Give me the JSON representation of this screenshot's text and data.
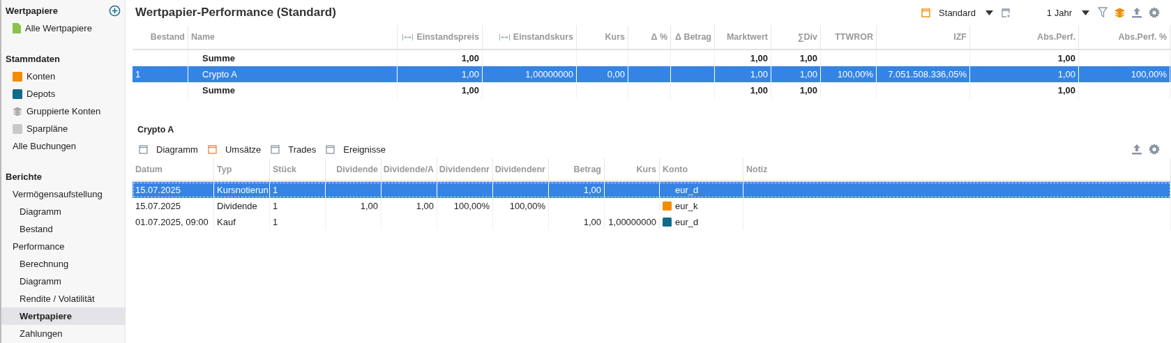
{
  "sidebar": {
    "sections": [
      {
        "title": "Wertpapiere",
        "add_button": true,
        "items": [
          {
            "label": "Alle Wertpapiere",
            "kind": "document",
            "color": "#8bc34a",
            "selected": false
          }
        ]
      },
      {
        "title": "Stammdaten",
        "items": [
          {
            "label": "Konten",
            "kind": "book",
            "color": "#f28c00",
            "selected": false
          },
          {
            "label": "Depots",
            "kind": "book",
            "color": "#0f6b8a",
            "selected": false
          },
          {
            "label": "Gruppierte Konten",
            "kind": "layers",
            "selected": false
          },
          {
            "label": "Sparpläne",
            "kind": "book",
            "color": "#c8c8c8",
            "selected": false
          },
          {
            "label": "Alle Buchungen",
            "kind": "plain",
            "selected": false
          }
        ]
      },
      {
        "title": "Berichte",
        "items": [
          {
            "label": "Vermögensaufstellung",
            "kind": "plain",
            "selected": false,
            "children": [
              {
                "label": "Diagramm",
                "selected": false
              },
              {
                "label": "Bestand",
                "selected": false
              }
            ]
          },
          {
            "label": "Performance",
            "kind": "plain",
            "selected": false,
            "children": [
              {
                "label": "Berechnung",
                "selected": false
              },
              {
                "label": "Diagramm",
                "selected": false
              },
              {
                "label": "Rendite / Volatilität",
                "selected": false
              },
              {
                "label": "Wertpapiere",
                "selected": true
              },
              {
                "label": "Zahlungen",
                "selected": false
              }
            ]
          }
        ]
      }
    ]
  },
  "page": {
    "title": "Wertpapier-Performance (Standard)",
    "toolbar": {
      "view": "Standard",
      "period": "1 Jahr"
    },
    "table": {
      "columns": [
        {
          "label": "Bestand"
        },
        {
          "label": "Name"
        },
        {
          "label": "Einstandspreis",
          "range_icon": true
        },
        {
          "label": "Einstandskurs",
          "range_icon": true
        },
        {
          "label": "Kurs"
        },
        {
          "label": "Δ %"
        },
        {
          "label": "Δ Betrag"
        },
        {
          "label": "Marktwert"
        },
        {
          "label": "∑Div"
        },
        {
          "label": "TTWROR"
        },
        {
          "label": "IZF"
        },
        {
          "label": "Abs.Perf."
        },
        {
          "label": "Abs.Perf. %"
        }
      ],
      "rows": [
        {
          "kind": "sum",
          "selected": false,
          "cells": [
            null,
            "Summe",
            "1,00",
            null,
            null,
            null,
            null,
            "1,00",
            "1,00",
            null,
            null,
            "1,00",
            null
          ]
        },
        {
          "kind": "position",
          "selected": true,
          "cells": [
            "1",
            "Crypto A",
            "1,00",
            "1,00000000",
            "0,00",
            null,
            null,
            "1,00",
            "1,00",
            "100,00%",
            "7.051.508.336,05%",
            "1,00",
            "100,00%"
          ]
        },
        {
          "kind": "sum",
          "selected": false,
          "cells": [
            null,
            "Summe",
            "1,00",
            null,
            null,
            null,
            null,
            "1,00",
            "1,00",
            null,
            null,
            "1,00",
            null
          ]
        }
      ]
    },
    "detail": {
      "title": "Crypto A",
      "tabs": [
        {
          "label": "Diagramm",
          "selected": false
        },
        {
          "label": "Umsätze",
          "selected": true
        },
        {
          "label": "Trades",
          "selected": false
        },
        {
          "label": "Ereignisse",
          "selected": false
        }
      ],
      "table": {
        "columns": [
          "Datum",
          "Typ",
          "Stück",
          "Dividende",
          "Dividende/A",
          "Dividendenr",
          "Dividendenr",
          "Betrag",
          "Kurs",
          "Konto",
          "Notiz"
        ],
        "rows": [
          {
            "selected": true,
            "cells": [
              "15.07.2025",
              "Kursnotierun",
              "1",
              null,
              null,
              null,
              null,
              "1,00",
              null,
              "eur_d",
              null
            ]
          },
          {
            "selected": false,
            "color": "#f28c00",
            "cells": [
              "15.07.2025",
              "Dividende",
              "1",
              "1,00",
              "1,00",
              "100,00%",
              "100,00%",
              null,
              null,
              "eur_k",
              null
            ]
          },
          {
            "selected": false,
            "color": "#0f6b8a",
            "cells": [
              "01.07.2025, 09:00",
              "Kauf",
              "1",
              null,
              null,
              null,
              null,
              "1,00",
              "1,00000000",
              "eur_d",
              null
            ]
          }
        ]
      }
    }
  }
}
